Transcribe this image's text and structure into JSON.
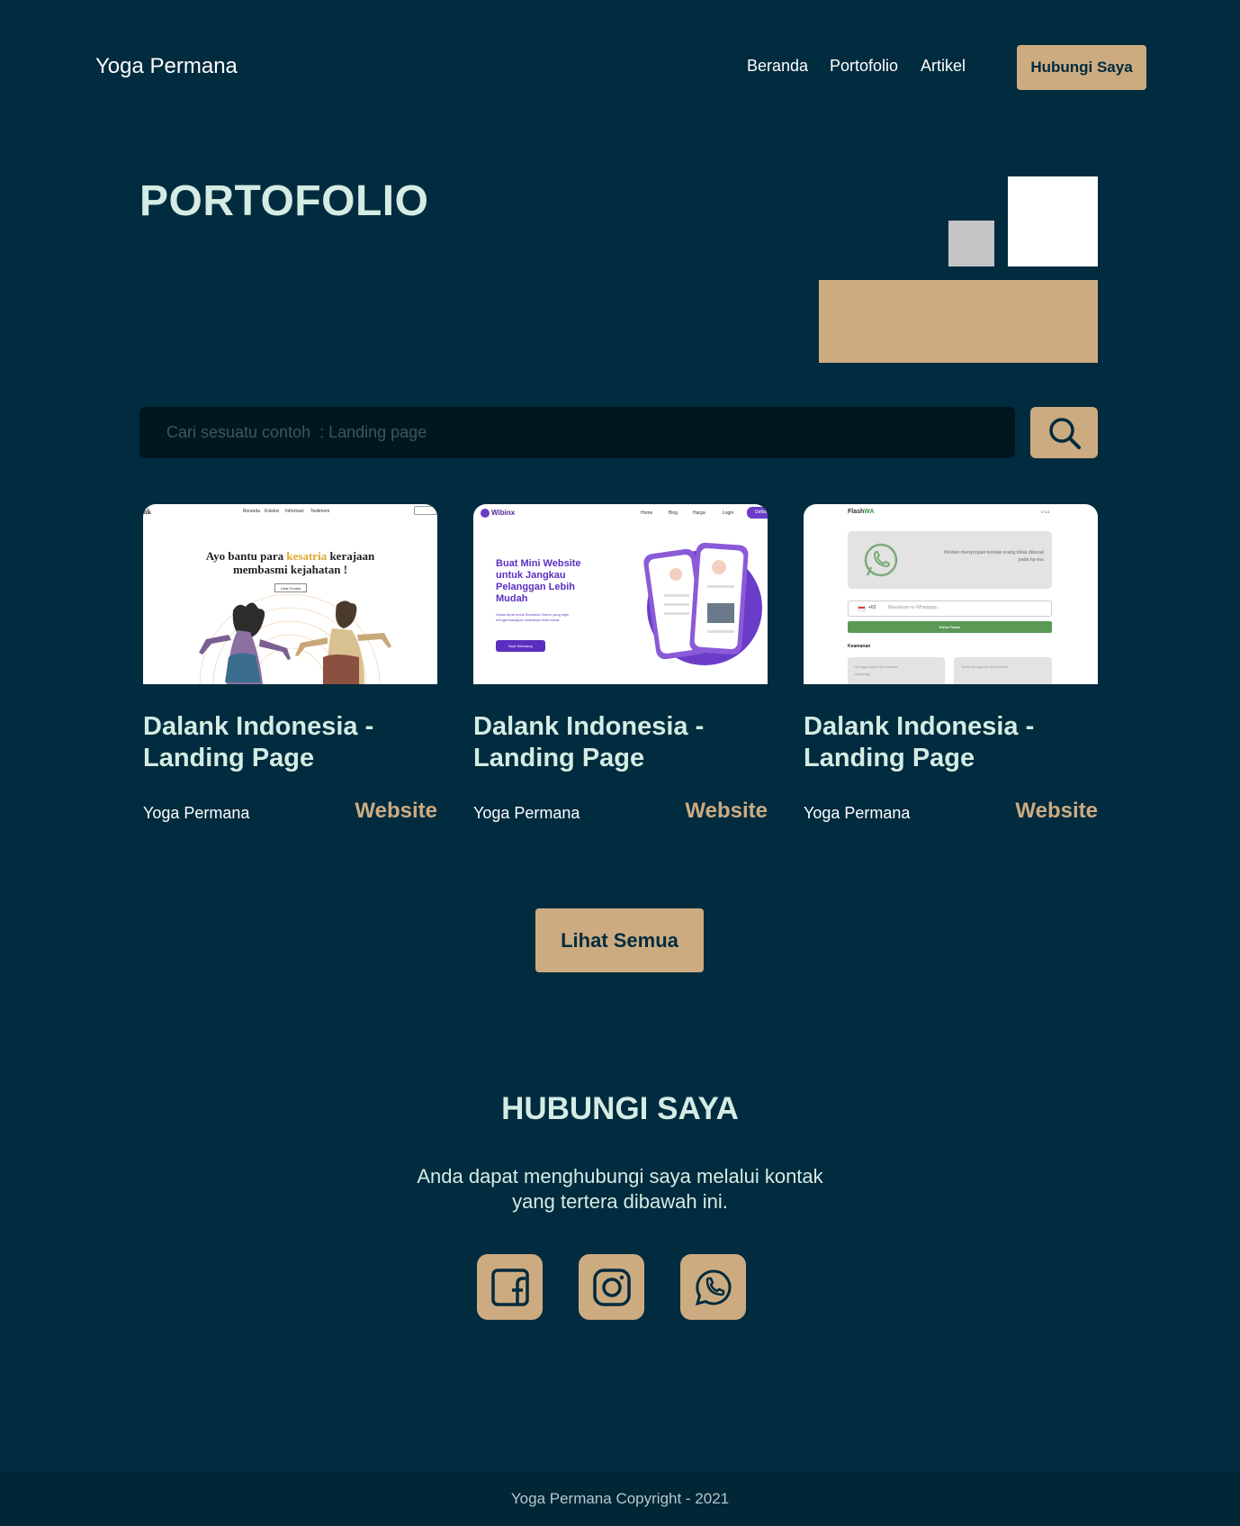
{
  "nav": {
    "brand": "Yoga Permana",
    "links": [
      "Beranda",
      "Portofolio",
      "Artikel"
    ],
    "cta": "Hubungi Saya"
  },
  "hero": {
    "title": "PORTOFOLIO"
  },
  "search": {
    "placeholder": "Cari sesuatu contoh  : Landing page",
    "icon": "search-icon"
  },
  "cards": [
    {
      "title": "Dalank Indonesia - Landing Page",
      "author": "Yoga Permana",
      "category": "Website",
      "thumb": {
        "logo": "nk",
        "nav": [
          "Beranda",
          "Koleksi",
          "Informasi",
          "Testimoni"
        ],
        "headline_1": "Ayo bantu para ",
        "headline_accent": "kesatria",
        "headline_2": " kerajaan",
        "headline_3": "membasmi kejahatan !",
        "button": "Lihat Produk"
      }
    },
    {
      "title": "Dalank Indonesia - Landing Page",
      "author": "Yoga Permana",
      "category": "Website",
      "thumb": {
        "logo": "Wibinx",
        "nav": [
          "Home",
          "Blog",
          "Harga",
          "Login"
        ],
        "nav_cta": "Daftar",
        "headline": "Buat Mini Website untuk Jangkau Pelanggan Lebih Mudah",
        "sub": "Solusi tepat untuk Business Owner yang ingin mengembangkan usahanya lebih hebat.",
        "button": "Buat Sekarang"
      }
    },
    {
      "title": "Dalank Indonesia - Landing Page",
      "author": "Yoga Permana",
      "category": "Website",
      "thumb": {
        "logo_a": "Flash",
        "logo_b": "WA",
        "version": "V 1.0",
        "banner": "Hindari menyimpan kontak orang tidak dikenal pada hp-mu",
        "code": "+62",
        "input_placeholder": "Masukkan no Whatsapp...",
        "button": "Kirim Pesan",
        "section": "Keamanan",
        "feature_1": "Menggunakan fitur bawaan whatsapp",
        "feature_2": "Tidak mengambil data pribadi"
      }
    }
  ],
  "see_all": "Lihat Semua",
  "contact": {
    "title": "HUBUNGI SAYA",
    "desc_1": "Anda dapat menghubungi saya melalui kontak",
    "desc_2": "yang tertera dibawah ini.",
    "socials": [
      "facebook-icon",
      "instagram-icon",
      "whatsapp-icon"
    ]
  },
  "footer": "Yoga Permana Copyright - 2021",
  "colors": {
    "background": "#012b3e",
    "accent": "#cdab81",
    "heading": "#d4ece4",
    "search_bg": "#011720",
    "footer_bg": "#012636"
  }
}
